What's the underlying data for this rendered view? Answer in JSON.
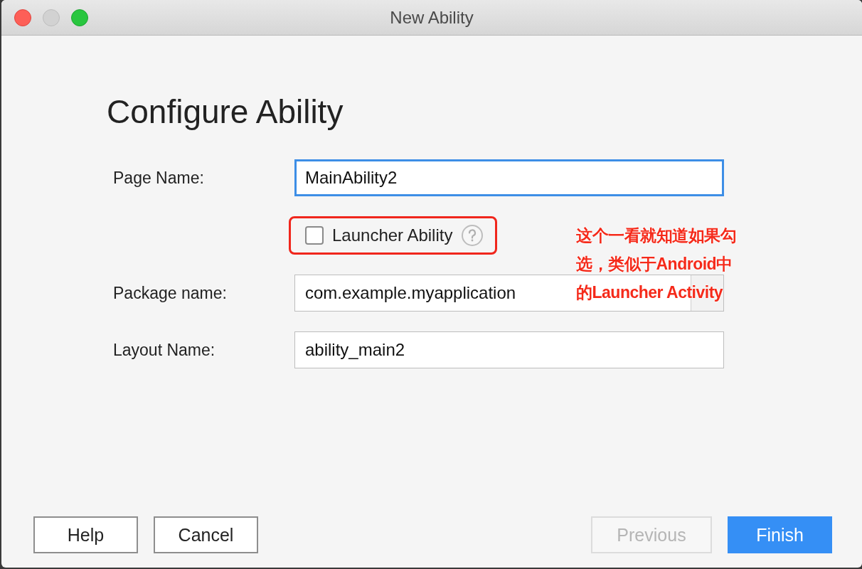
{
  "window": {
    "title": "New Ability"
  },
  "heading": "Configure Ability",
  "fields": [
    {
      "label": "Page Name:",
      "value": "MainAbility2",
      "focused": true,
      "kind": "text"
    },
    {
      "label": "Launcher Ability",
      "checked": false,
      "kind": "checkbox",
      "highlighted": true
    },
    {
      "label": "Package name:",
      "value": "com.example.myapplication",
      "focused": false,
      "kind": "combo"
    },
    {
      "label": "Layout Name:",
      "value": "ability_main2",
      "focused": false,
      "kind": "text"
    }
  ],
  "annotation": [
    "这个一看就知道如果勾",
    "选，类似于Android中",
    "的Launcher Activity"
  ],
  "left_buttons": [
    {
      "label": "Help",
      "disabled": false,
      "primary": false
    },
    {
      "label": "Cancel",
      "disabled": false,
      "primary": false
    }
  ],
  "right_buttons": [
    {
      "label": "Previous",
      "disabled": true,
      "primary": false
    },
    {
      "label": "Finish",
      "disabled": false,
      "primary": true
    }
  ]
}
